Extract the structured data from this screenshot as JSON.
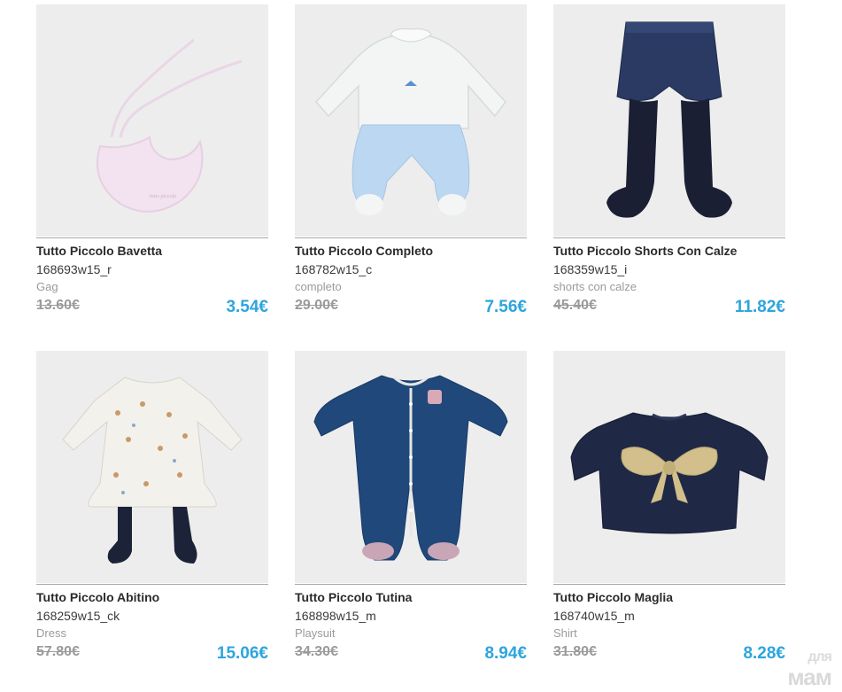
{
  "products": [
    {
      "name": "Tutto Piccolo Bavetta",
      "sku": "168693w15_r",
      "category": "Gag",
      "old_price": "13.60€",
      "price": "3.54€",
      "icon": "bib-image"
    },
    {
      "name": "Tutto Piccolo Completo",
      "sku": "168782w15_c",
      "category": "completo",
      "old_price": "29.00€",
      "price": "7.56€",
      "icon": "outfit-set-image"
    },
    {
      "name": "Tutto Piccolo Shorts Con Calze",
      "sku": "168359w15_i",
      "category": "shorts con calze",
      "old_price": "45.40€",
      "price": "11.82€",
      "icon": "shorts-with-tights-image"
    },
    {
      "name": "Tutto Piccolo Abitino",
      "sku": "168259w15_ck",
      "category": "Dress",
      "old_price": "57.80€",
      "price": "15.06€",
      "icon": "floral-dress-image"
    },
    {
      "name": "Tutto Piccolo Tutina",
      "sku": "168898w15_m",
      "category": "Playsuit",
      "old_price": "34.30€",
      "price": "8.94€",
      "icon": "playsuit-image"
    },
    {
      "name": "Tutto Piccolo Maglia",
      "sku": "168740w15_m",
      "category": "Shirt",
      "old_price": "31.80€",
      "price": "8.28€",
      "icon": "sweater-bow-image"
    }
  ],
  "watermark": {
    "line1": "для",
    "line2": "мам"
  },
  "colors": {
    "price": "#2da5dd",
    "old_price": "#9a9a9a",
    "image_bg": "#ededed"
  }
}
